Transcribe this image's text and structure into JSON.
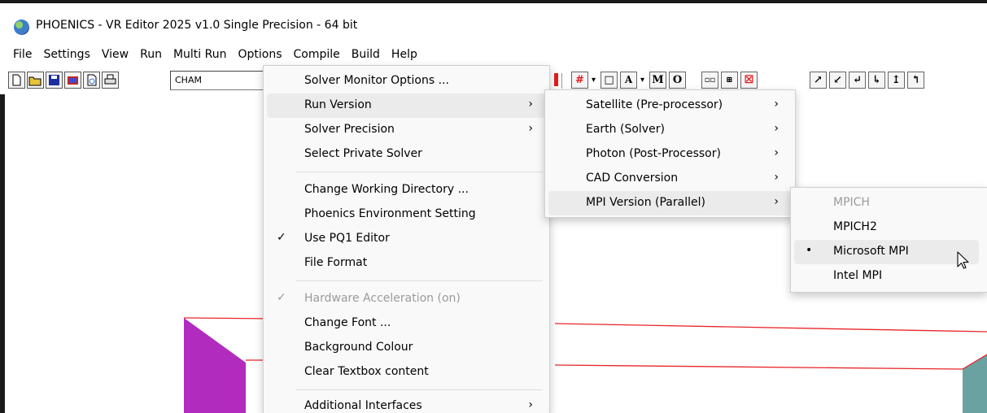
{
  "window": {
    "title": "PHOENICS - VR Editor 2025 v1.0 Single Precision - 64 bit"
  },
  "menubar": [
    "File",
    "Settings",
    "View",
    "Run",
    "Multi Run",
    "Options",
    "Compile",
    "Build",
    "Help"
  ],
  "toolbar": {
    "case_name": "CHAM",
    "view_buttons": [
      "M",
      "O"
    ]
  },
  "options_menu": {
    "items": [
      {
        "label": "Solver Monitor Options ...",
        "submenu": false
      },
      {
        "label": "Run Version",
        "submenu": true,
        "highlighted": true
      },
      {
        "label": "Solver Precision",
        "submenu": true
      },
      {
        "label": "Select Private Solver",
        "submenu": false
      },
      {
        "label": "Change Working Directory ...",
        "submenu": false
      },
      {
        "label": "Phoenics Environment Setting",
        "submenu": false
      },
      {
        "label": "Use PQ1 Editor",
        "checked": true
      },
      {
        "label": "File Format",
        "submenu": false
      },
      {
        "label": "Hardware Acceleration (on)",
        "checked": true,
        "disabled": true
      },
      {
        "label": "Change Font ...",
        "submenu": false
      },
      {
        "label": "Background Colour",
        "submenu": false
      },
      {
        "label": "Clear Textbox content",
        "submenu": false
      },
      {
        "label": "Additional Interfaces",
        "submenu": true
      }
    ]
  },
  "run_version_menu": {
    "items": [
      {
        "label": "Satellite (Pre-processor)",
        "submenu": true
      },
      {
        "label": "Earth (Solver)",
        "submenu": true
      },
      {
        "label": "Photon (Post-Processor)",
        "submenu": true
      },
      {
        "label": "CAD Conversion",
        "submenu": true
      },
      {
        "label": "MPI Version (Parallel)",
        "submenu": true,
        "highlighted": true
      }
    ]
  },
  "mpi_menu": {
    "items": [
      {
        "label": "MPICH",
        "disabled": true
      },
      {
        "label": "MPICH2"
      },
      {
        "label": "Microsoft MPI",
        "selected": true,
        "highlighted": true
      },
      {
        "label": "Intel MPI"
      }
    ]
  },
  "glyphs": {
    "check": "✓",
    "arrow": "›",
    "bullet": "•"
  },
  "colors": {
    "magenta_block": "#b22bbf",
    "teal_block": "#6aa2a2",
    "outline": "#e8262a"
  }
}
